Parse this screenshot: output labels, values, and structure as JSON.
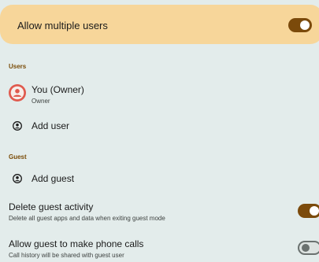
{
  "banner": {
    "label": "Allow multiple users",
    "toggle_on": true
  },
  "users_section": {
    "header": "Users",
    "owner": {
      "title": "You (Owner)",
      "subtitle": "Owner"
    },
    "add_user": "Add user"
  },
  "guest_section": {
    "header": "Guest",
    "add_guest": "Add guest",
    "delete_activity": {
      "title": "Delete guest activity",
      "subtitle": "Delete all guest apps and data when exiting guest mode",
      "toggle_on": true
    },
    "phone_calls": {
      "title": "Allow guest to make phone calls",
      "subtitle": "Call history will be shared with guest user",
      "toggle_on": false
    }
  },
  "colors": {
    "accent": "#7b4a0b",
    "banner": "#f7d69a",
    "background": "#e3eceb",
    "owner_avatar": "#e05a4e"
  }
}
